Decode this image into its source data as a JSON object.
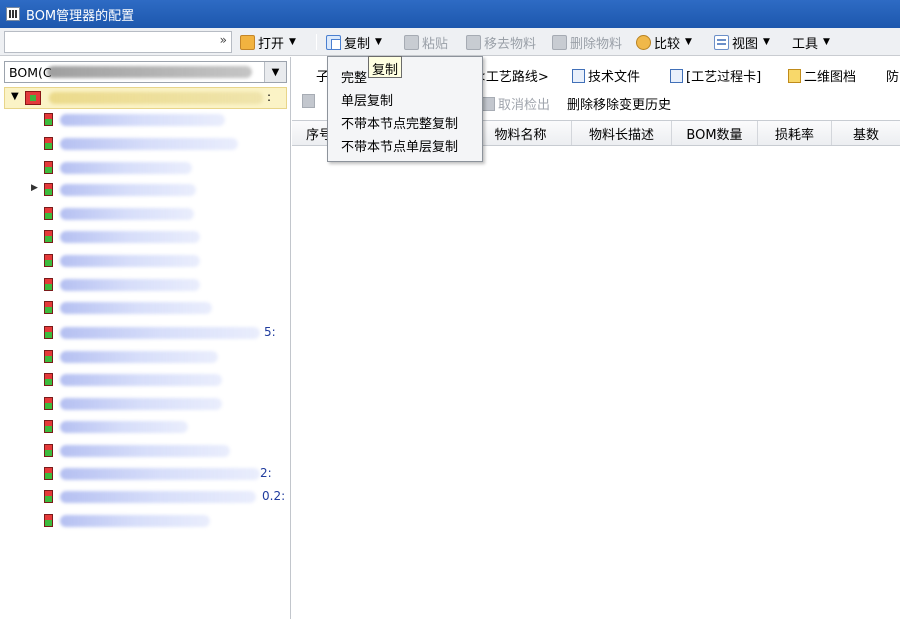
{
  "window": {
    "title": "BOM管理器的配置"
  },
  "toolbar": {
    "open": "打开",
    "copy": "复制",
    "paste": "粘贴",
    "move_material": "移去物料",
    "delete_material": "删除物料",
    "compare": "比较",
    "view": "视图",
    "tools": "工具"
  },
  "left": {
    "bom_combo_value": "BOM(C",
    "root_suffix": ":",
    "row_suffixes": {
      "row14": "5:",
      "row21": "2:",
      "row22": "0.2:"
    }
  },
  "tabs": {
    "sub": "子",
    "route": "<工艺路线>",
    "tech_file": "技术文件",
    "process_card": "[工艺过程卡]",
    "qr": "二维图档",
    "extra": "防"
  },
  "subtoolbar": {
    "cancel_checkout": "取消检出",
    "delete_history": "删除移除变更历史"
  },
  "grid": {
    "columns": [
      "序号",
      "物料名称",
      "物料长描述",
      "BOM数量",
      "损耗率",
      "基数"
    ]
  },
  "copy_menu": {
    "items": [
      "完整",
      "单层复制",
      "不带本节点完整复制",
      "不带本节点单层复制"
    ],
    "tooltip": "复制"
  }
}
